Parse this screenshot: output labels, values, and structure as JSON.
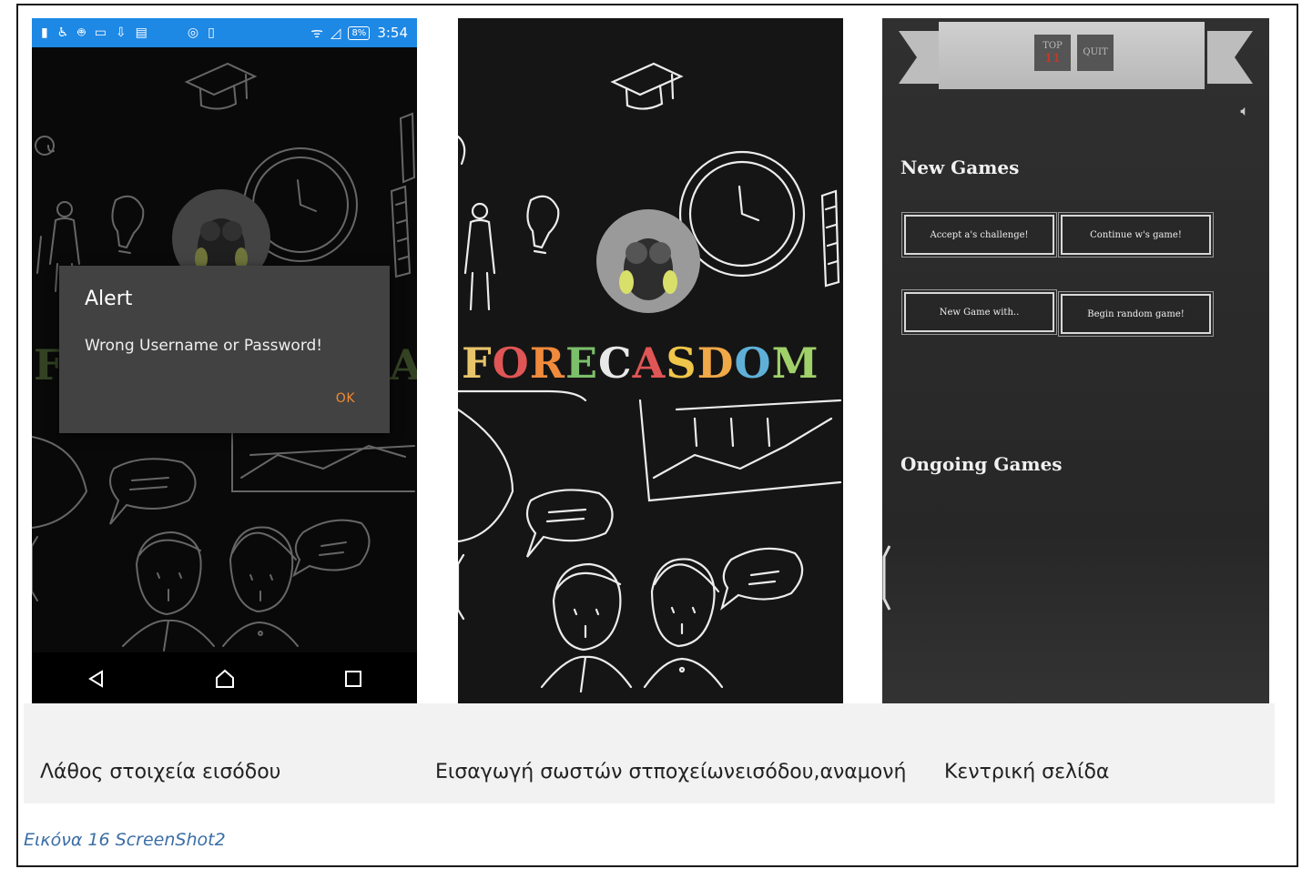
{
  "captions": [
    "Λάθος στοιχεία εισόδου",
    "Εισαγωγή σωστών στποχείωνεισόδου,αναμονή",
    "Κεντρική σελίδα"
  ],
  "figure_label": "Εικόνα 16 ScreenShot2",
  "screen1": {
    "status_bar": {
      "time": "3:54",
      "battery": "8%",
      "color": "#1e88e5"
    },
    "alert": {
      "title": "Alert",
      "message": "Wrong Username or Password!",
      "ok_label": "OK",
      "ok_color": "#f28b30"
    },
    "nav_icons": [
      "back-icon",
      "home-icon",
      "recents-icon"
    ]
  },
  "screen2": {
    "logo_letters": [
      {
        "ch": "F",
        "color": "#e8c46a"
      },
      {
        "ch": "O",
        "color": "#e05555"
      },
      {
        "ch": "R",
        "color": "#f08a3c"
      },
      {
        "ch": "E",
        "color": "#7bbf6a"
      },
      {
        "ch": "C",
        "color": "#e8e8e8"
      },
      {
        "ch": "A",
        "color": "#e05555"
      },
      {
        "ch": "S",
        "color": "#f0c64a"
      },
      {
        "ch": "D",
        "color": "#f0a848"
      },
      {
        "ch": "O",
        "color": "#5fb0d8"
      },
      {
        "ch": "M",
        "color": "#9fd06a"
      }
    ]
  },
  "screen3": {
    "top_button": "TOP",
    "top_number": "11",
    "quit_button": "QUIT",
    "new_games_title": "New Games",
    "buttons": [
      "Accept a's challenge!",
      "Continue w's game!",
      "New Game with..",
      "Begin random game!"
    ],
    "ongoing_games_title": "Ongoing Games"
  }
}
